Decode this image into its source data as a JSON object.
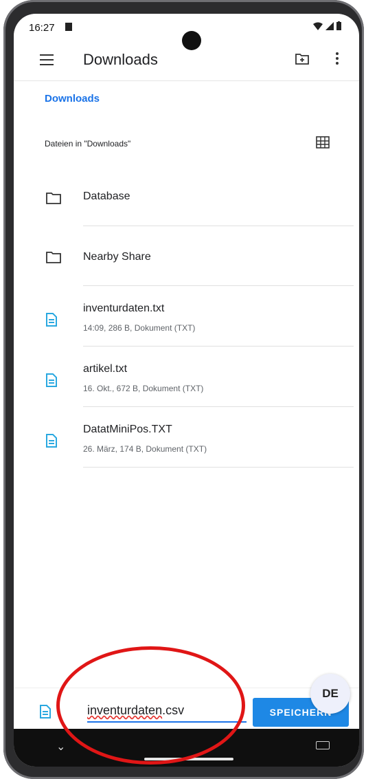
{
  "status": {
    "time": "16:27"
  },
  "appbar": {
    "title": "Downloads"
  },
  "breadcrumb": "Downloads",
  "section_label": "Dateien in \"Downloads\"",
  "folders": [
    {
      "name": "Database",
      "icon": "folder-icon"
    },
    {
      "name": "Nearby Share",
      "icon": "folder-icon"
    }
  ],
  "files": [
    {
      "name": "inventurdaten.txt",
      "meta": "14:09, 286 B, Dokument (TXT)",
      "icon": "document-icon"
    },
    {
      "name": "artikel.txt",
      "meta": "16. Okt., 672 B, Dokument (TXT)",
      "icon": "document-icon"
    },
    {
      "name": "DatatMiniPos.TXT",
      "meta": "26. März, 174 B, Dokument (TXT)",
      "icon": "document-icon"
    }
  ],
  "save": {
    "filename_base": "inventurdaten",
    "filename_ext": ".csv",
    "button_label": "SPEICHERN"
  },
  "keyboard": {
    "language": "DE"
  },
  "colors": {
    "accent": "#1a73e8",
    "file_icon": "#29a8e0",
    "annotation": "#e01616"
  }
}
